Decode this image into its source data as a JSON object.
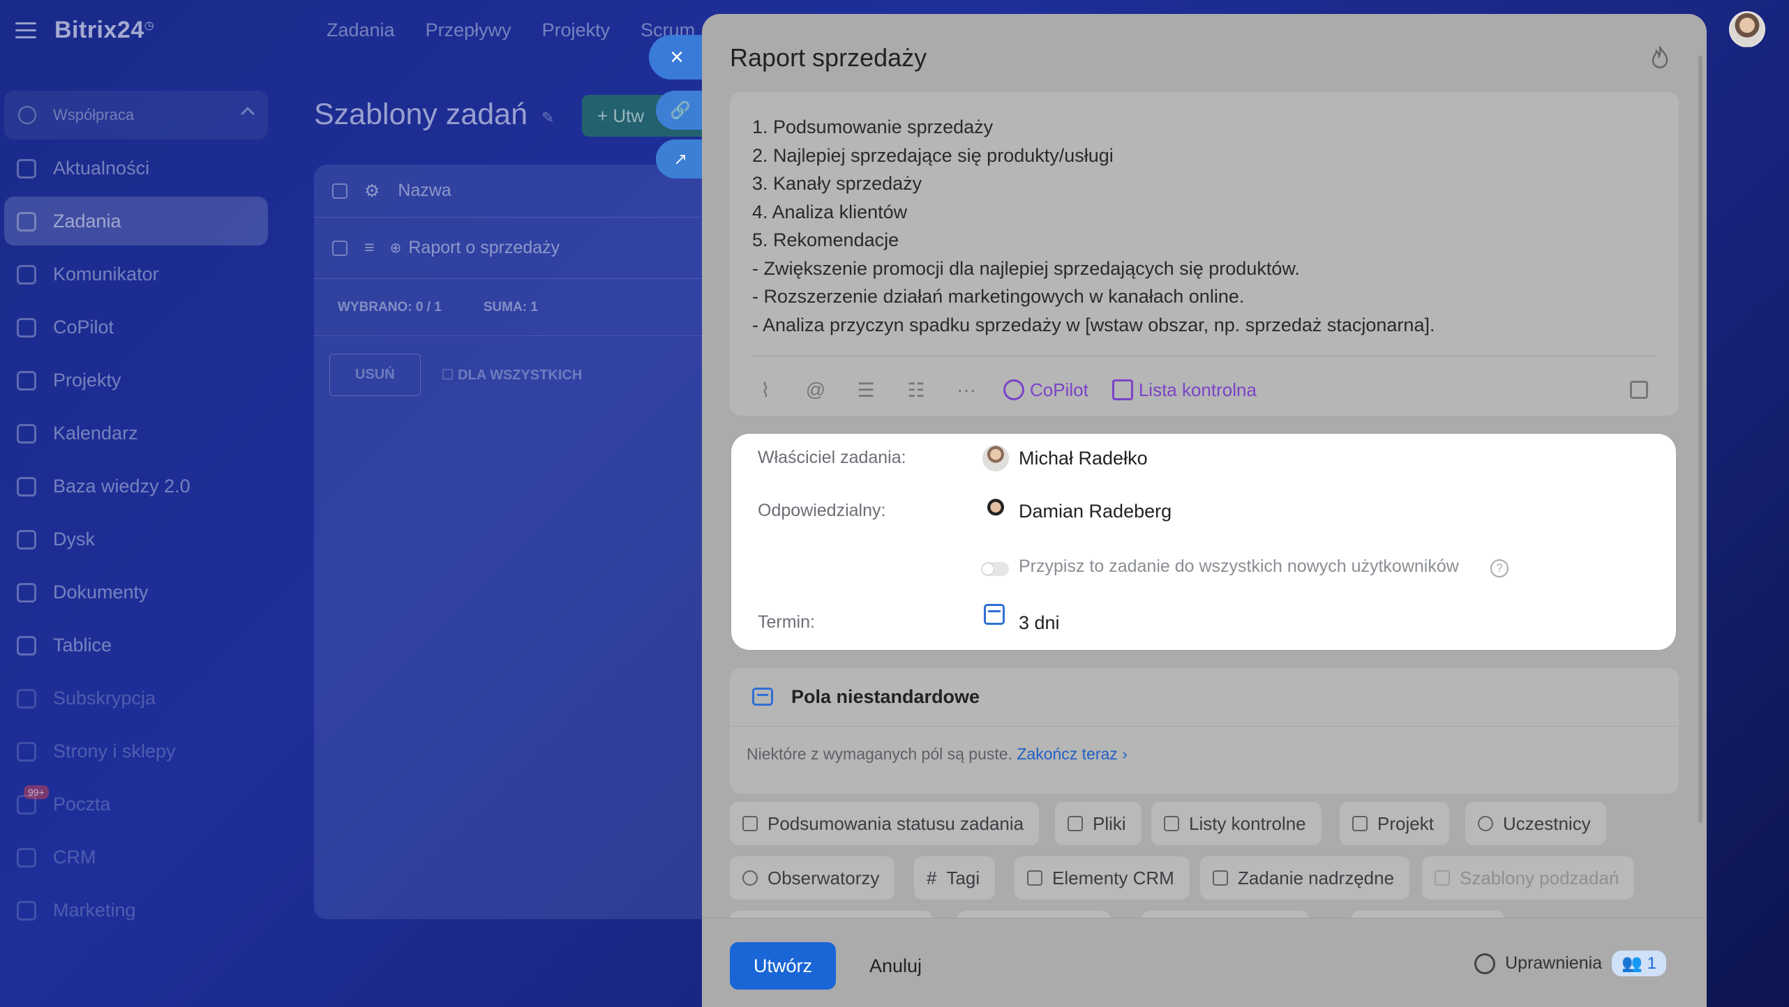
{
  "app": {
    "logo": "Bitrix24"
  },
  "topnav": [
    "Zadania",
    "Przepływy",
    "Projekty",
    "Scrum"
  ],
  "sidebar": {
    "group_label": "Współpraca",
    "items": [
      {
        "label": "Aktualności"
      },
      {
        "label": "Zadania"
      },
      {
        "label": "Komunikator"
      },
      {
        "label": "CoPilot"
      },
      {
        "label": "Projekty"
      },
      {
        "label": "Kalendarz"
      },
      {
        "label": "Baza wiedzy 2.0"
      },
      {
        "label": "Dysk"
      },
      {
        "label": "Dokumenty"
      },
      {
        "label": "Tablice"
      },
      {
        "label": "Subskrypcja"
      },
      {
        "label": "Strony i sklepy"
      },
      {
        "label": "Poczta"
      },
      {
        "label": "CRM"
      },
      {
        "label": "Marketing"
      }
    ],
    "poczta_badge": "99+"
  },
  "page": {
    "title": "Szablony zadań",
    "create_label": "+ Utw",
    "grid": {
      "column_name": "Nazwa",
      "row_name": "Raport o sprzedaży",
      "selected": "WYBRANO: 0 / 1",
      "total": "SUMA: 1",
      "delete": "USUŃ",
      "for_all": "DLA WSZYSTKICH"
    }
  },
  "slider": {
    "title": "Raport sprzedaży",
    "description": [
      "1. Podsumowanie sprzedaży",
      "2. Najlepiej sprzedające się produkty/usługi",
      "3. Kanały sprzedaży",
      "4. Analiza klientów",
      "5. Rekomendacje",
      "- Zwiększenie promocji dla najlepiej sprzedających się produktów.",
      "- Rozszerzenie działań marketingowych w kanałach online.",
      "- Analiza przyczyn spadku sprzedaży w [wstaw obszar, np. sprzedaż stacjonarna]."
    ],
    "toolbar": {
      "copilot": "CoPilot",
      "checklist": "Lista kontrolna"
    },
    "owner_label": "Właściciel zadania:",
    "owner_name": "Michał Radełko",
    "responsible_label": "Odpowiedzialny:",
    "responsible_name": "Damian Radeberg",
    "assign_all": "Przypisz to zadanie do wszystkich nowych użytkowników",
    "deadline_label": "Termin:",
    "deadline_value": "3 dni",
    "custom_fields_title": "Pola niestandardowe",
    "custom_note": "Niektóre z wymaganych pól są puste.",
    "custom_link": "Zakończ teraz",
    "chips": [
      "Podsumowania statusu zadania",
      "Pliki",
      "Listy kontrolne",
      "Projekt",
      "Uczestnicy",
      "Obserwatorzy",
      "Tagi",
      "Elementy CRM",
      "Zadanie nadrzędne",
      "Szablony podzadań"
    ],
    "footer": {
      "create": "Utwórz",
      "cancel": "Anuluj",
      "permissions": "Uprawnienia",
      "permissions_count": "1"
    }
  }
}
